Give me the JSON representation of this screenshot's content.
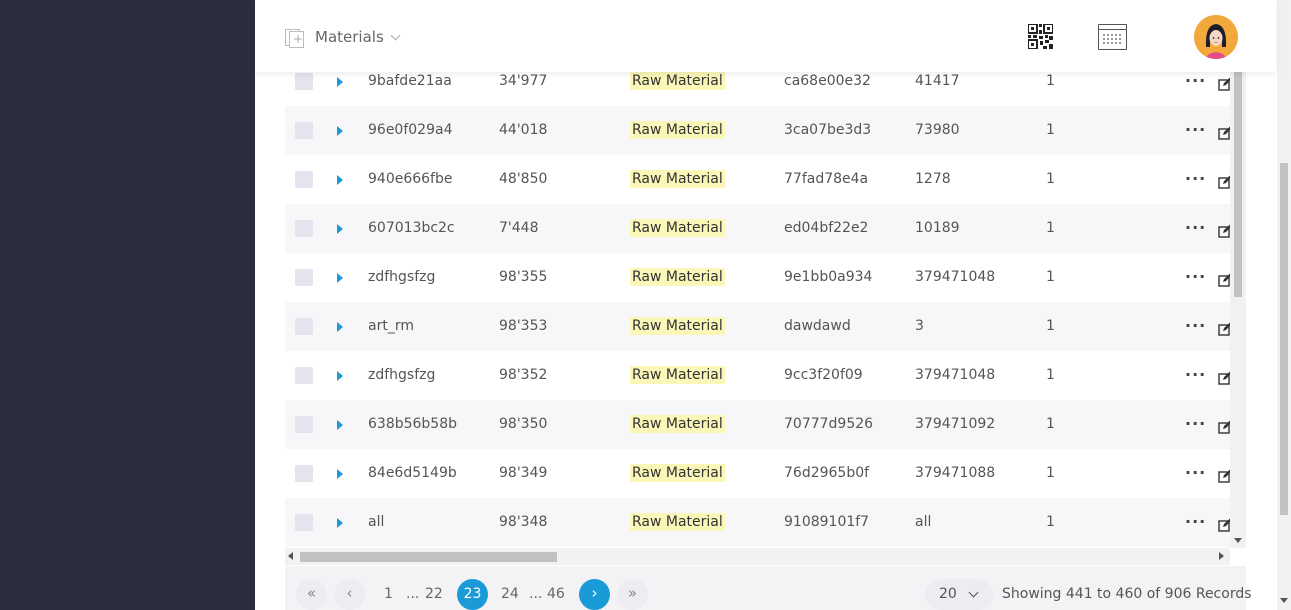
{
  "header": {
    "breadcrumb_label": "Materials",
    "breadcrumb_icon": "add-page-icon",
    "qr_icon": "qr-code-icon",
    "calendar_icon": "calendar-icon",
    "avatar_icon": "user-avatar"
  },
  "colors": {
    "sidebar": "#2c2d3f",
    "accent": "#1a9ad6",
    "tag_bg": "#fbf7b8"
  },
  "rows": [
    {
      "code": "9bafde21aa",
      "qty": "34'977",
      "type": "Raw Material",
      "ref": "ca68e00e32",
      "num": "41417",
      "count": "1"
    },
    {
      "code": "96e0f029a4",
      "qty": "44'018",
      "type": "Raw Material",
      "ref": "3ca07be3d3",
      "num": "73980",
      "count": "1"
    },
    {
      "code": "940e666fbe",
      "qty": "48'850",
      "type": "Raw Material",
      "ref": "77fad78e4a",
      "num": "1278",
      "count": "1"
    },
    {
      "code": "607013bc2c",
      "qty": "7'448",
      "type": "Raw Material",
      "ref": "ed04bf22e2",
      "num": "10189",
      "count": "1"
    },
    {
      "code": "zdfhgsfzg",
      "qty": "98'355",
      "type": "Raw Material",
      "ref": "9e1bb0a934",
      "num": "379471048",
      "count": "1"
    },
    {
      "code": "art_rm",
      "qty": "98'353",
      "type": "Raw Material",
      "ref": "dawdawd",
      "num": "3",
      "count": "1"
    },
    {
      "code": "zdfhgsfzg",
      "qty": "98'352",
      "type": "Raw Material",
      "ref": "9cc3f20f09",
      "num": "379471048",
      "count": "1"
    },
    {
      "code": "638b56b58b",
      "qty": "98'350",
      "type": "Raw Material",
      "ref": "70777d9526",
      "num": "379471092",
      "count": "1"
    },
    {
      "code": "84e6d5149b",
      "qty": "98'349",
      "type": "Raw Material",
      "ref": "76d2965b0f",
      "num": "379471088",
      "count": "1"
    },
    {
      "code": "all",
      "qty": "98'348",
      "type": "Raw Material",
      "ref": "91089101f7",
      "num": "all",
      "count": "1"
    }
  ],
  "row_more_label": "···",
  "pagination": {
    "first": "«",
    "prev": "‹",
    "next": "›",
    "last": "»",
    "pages": [
      "1",
      "...",
      "22",
      "23",
      "24",
      "...",
      "46"
    ],
    "active": "23",
    "page_size": "20",
    "summary": "Showing 441 to 460 of 906 Records"
  }
}
